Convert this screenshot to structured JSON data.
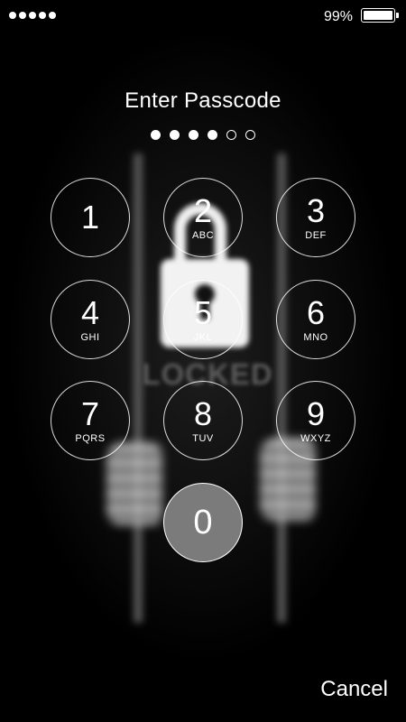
{
  "status_bar": {
    "signal_dots": 5,
    "battery_percent": "99%",
    "battery_level": 0.99
  },
  "title": "Enter Passcode",
  "passcode": {
    "length": 6,
    "entered": 4
  },
  "keypad": {
    "k1": {
      "digit": "1",
      "letters": ""
    },
    "k2": {
      "digit": "2",
      "letters": "ABC"
    },
    "k3": {
      "digit": "3",
      "letters": "DEF"
    },
    "k4": {
      "digit": "4",
      "letters": "GHI"
    },
    "k5": {
      "digit": "5",
      "letters": "JKL"
    },
    "k6": {
      "digit": "6",
      "letters": "MNO"
    },
    "k7": {
      "digit": "7",
      "letters": "PQRS"
    },
    "k8": {
      "digit": "8",
      "letters": "TUV"
    },
    "k9": {
      "digit": "9",
      "letters": "WXYZ"
    },
    "k0": {
      "digit": "0",
      "letters": ""
    },
    "pressed_key": "0"
  },
  "wallpaper": {
    "text": "LOCKED"
  },
  "cancel_label": "Cancel",
  "colors": {
    "background": "#000000",
    "foreground": "#ffffff",
    "pressed_key": "#7b7b7b"
  }
}
